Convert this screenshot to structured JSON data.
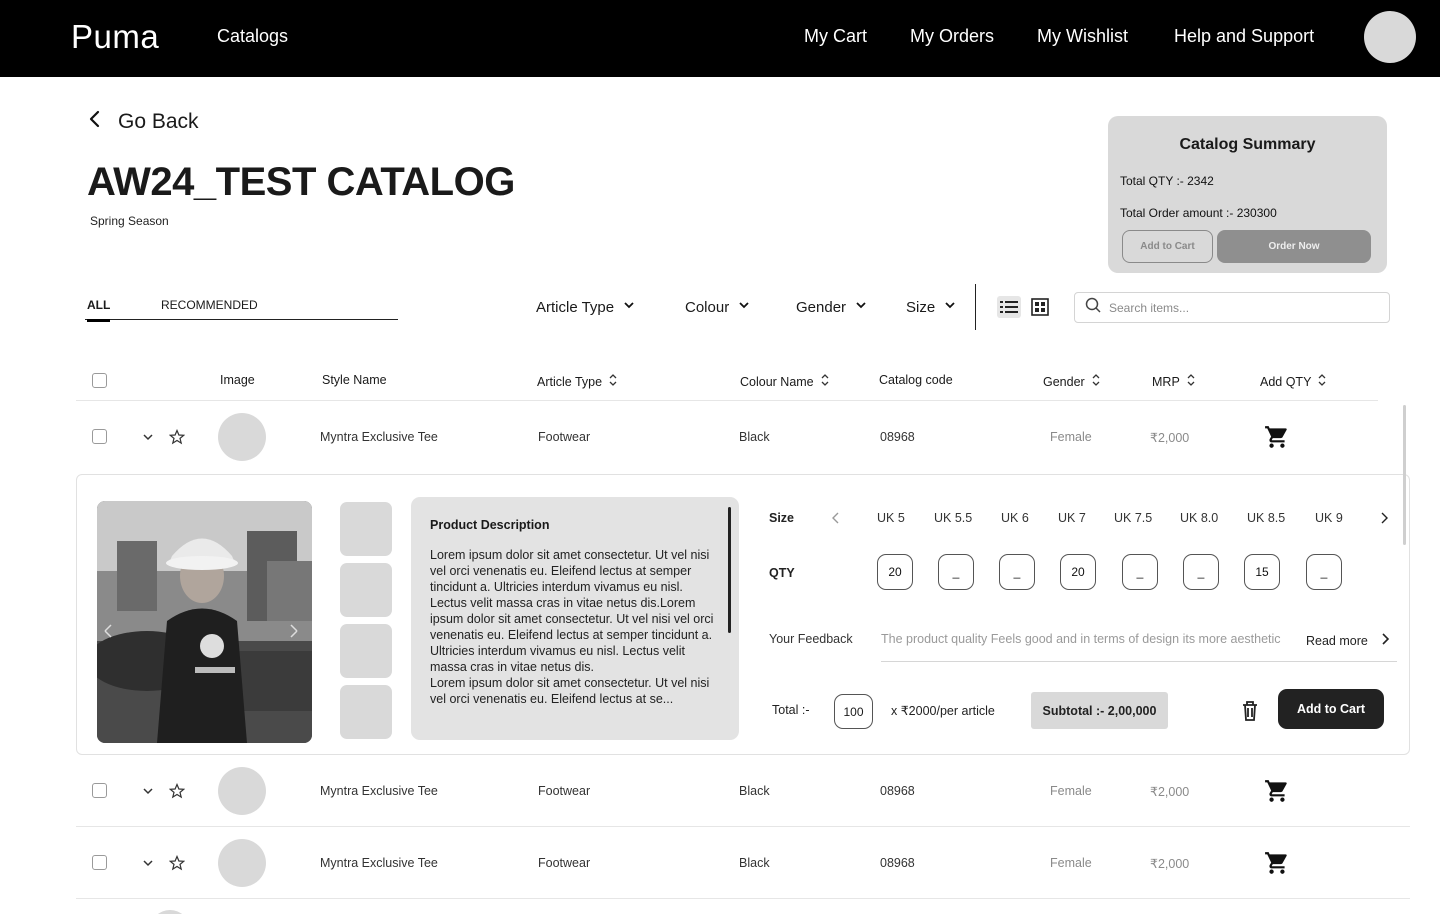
{
  "nav": {
    "brand": "Puma",
    "catalogs": "Catalogs",
    "links": [
      "My Cart",
      "My Orders",
      "My Wishlist",
      "Help and Support"
    ]
  },
  "header": {
    "go_back": "Go Back",
    "title": "AW24_TEST CATALOG",
    "subtitle": "Spring Season"
  },
  "summary": {
    "title": "Catalog Summary",
    "total_qty": "Total QTY :- 2342",
    "total_amount": "Total Order amount :- 230300",
    "add_to_cart": "Add to Cart",
    "order_now": "Order Now"
  },
  "tabs": [
    "ALL",
    "RECOMMENDED"
  ],
  "filters": [
    "Article Type",
    "Colour",
    "Gender",
    "Size"
  ],
  "search": {
    "placeholder": "Search items..."
  },
  "table": {
    "headers": [
      "Image",
      "Style Name",
      "Article Type",
      "Colour Name",
      "Catalog code",
      "Gender",
      "MRP",
      "Add QTY"
    ],
    "rows": [
      {
        "style": "Myntra Exclusive Tee",
        "article": "Footwear",
        "colour": "Black",
        "code": "08968",
        "gender": "Female",
        "mrp": "₹2,000"
      },
      {
        "style": "Myntra Exclusive Tee",
        "article": "Footwear",
        "colour": "Black",
        "code": "08968",
        "gender": "Female",
        "mrp": "₹2,000"
      },
      {
        "style": "Myntra Exclusive Tee",
        "article": "Footwear",
        "colour": "Black",
        "code": "08968",
        "gender": "Female",
        "mrp": "₹2,000"
      }
    ]
  },
  "expanded": {
    "desc_title": "Product Description",
    "desc_body": "Lorem ipsum dolor sit amet consectetur. Ut vel nisi vel orci venenatis eu. Eleifend lectus at semper tincidunt a. Ultricies interdum vivamus eu nisl. Lectus velit massa cras in vitae netus dis.Lorem ipsum dolor sit amet consectetur. Ut vel nisi vel orci venenatis eu. Eleifend lectus at semper tincidunt a. Ultricies interdum vivamus eu nisl. Lectus velit massa cras in vitae netus dis.\nLorem ipsum dolor sit amet consectetur. Ut vel nisi vel orci venenatis eu. Eleifend lectus at se...",
    "size_label": "Size",
    "sizes": [
      "UK 5",
      "UK 5.5",
      "UK 6",
      "UK 7",
      "UK 7.5",
      "UK 8.0",
      "UK 8.5",
      "UK 9"
    ],
    "qty_label": "QTY",
    "qtys": [
      "20",
      "_",
      "_",
      "20",
      "_",
      "_",
      "15",
      "_"
    ],
    "feedback_label": "Your Feedback",
    "feedback_text": "The product quality Feels good and in terms of design its more aesthetic",
    "read_more": "Read more",
    "total_label": "Total :-",
    "total_qty": "100",
    "per_article": "x ₹2000/per article",
    "subtotal": "Subtotal :- 2,00,000",
    "add_to_cart": "Add to Cart"
  },
  "icons": [
    "back-arrow-icon",
    "chevron-down-icon",
    "list-view-icon",
    "grid-view-icon",
    "search-icon",
    "sort-icon",
    "star-icon",
    "cart-icon",
    "trash-icon",
    "chevron-left-icon",
    "chevron-right-icon"
  ]
}
